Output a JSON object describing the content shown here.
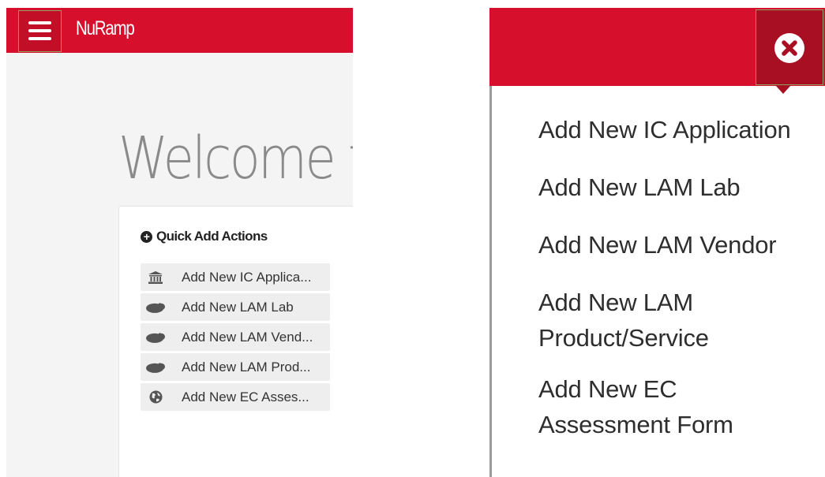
{
  "left": {
    "brand": "NuRamp",
    "welcome": "Welcome t",
    "quick_actions": {
      "title": "Quick Add Actions",
      "items": [
        {
          "label": "Add New IC Applica...",
          "icon": "bank-icon"
        },
        {
          "label": "Add New LAM Lab",
          "icon": "guinea-pig-icon"
        },
        {
          "label": "Add New LAM Vend...",
          "icon": "guinea-pig-icon"
        },
        {
          "label": "Add New LAM Prod...",
          "icon": "guinea-pig-icon"
        },
        {
          "label": "Add New EC Asses...",
          "icon": "globe-icon"
        }
      ]
    }
  },
  "right": {
    "menu": [
      "Add New IC Application",
      "Add New LAM Lab",
      "Add New LAM Vendor",
      "Add New LAM Product/Service",
      "Add New EC Assessment Form"
    ]
  },
  "colors": {
    "header_red": "#d50f2c",
    "close_tab_red": "#a80f22",
    "focus_outline": "#8fa25f"
  }
}
